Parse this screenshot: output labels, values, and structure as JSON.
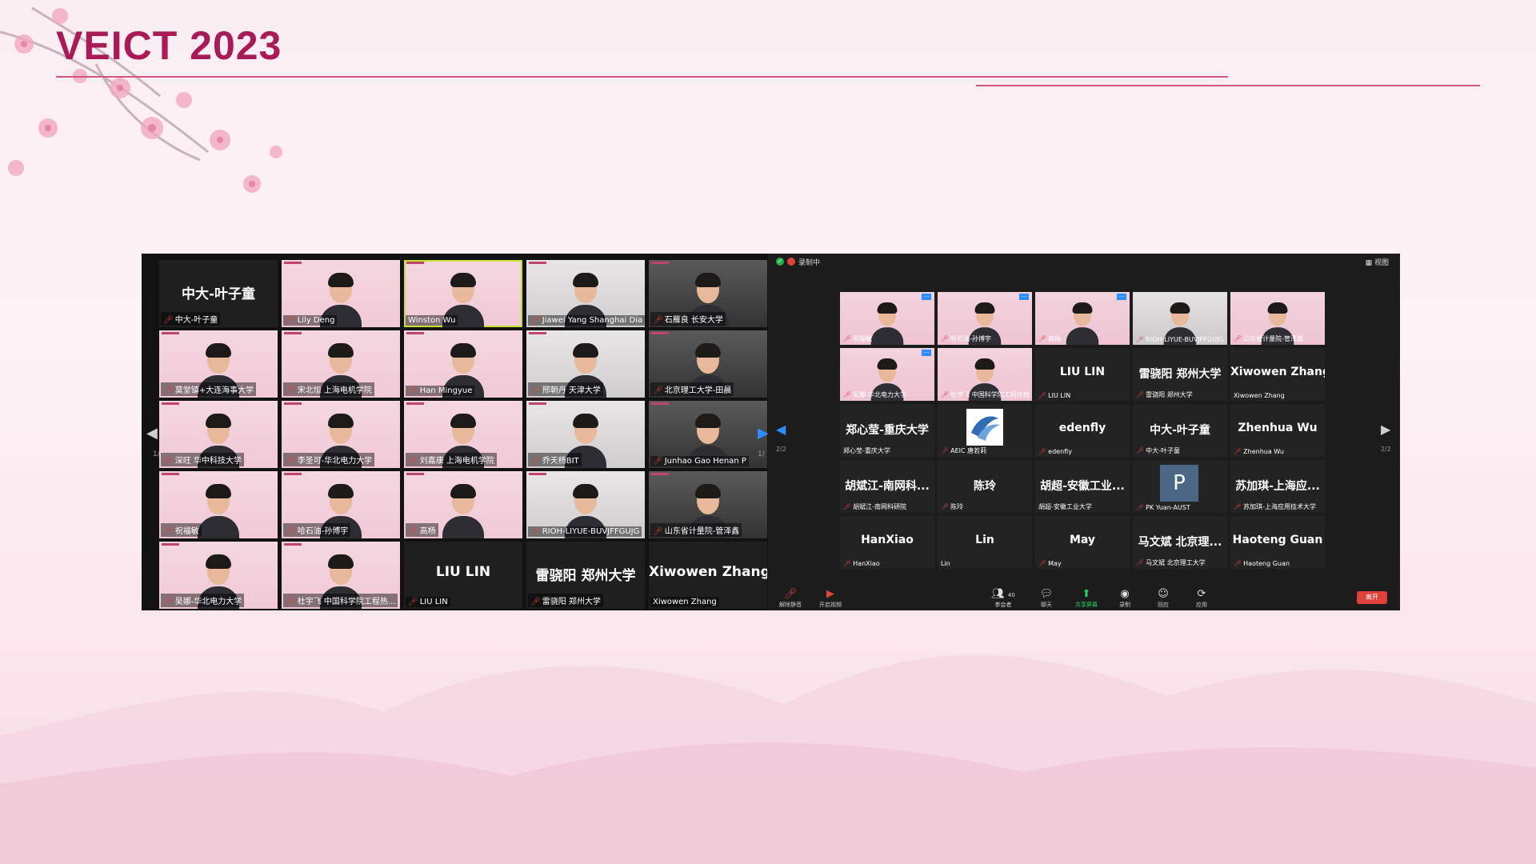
{
  "slide": {
    "title": "VEICT 2023"
  },
  "left_gallery": {
    "page_indicator_left": "1/2",
    "page_indicator_right": "1/",
    "tiles": [
      {
        "label": "中大-叶子童",
        "big": "中大-叶子童",
        "muted": true
      },
      {
        "label": "Lily Deng",
        "muted": true
      },
      {
        "label": "Winston Wu",
        "muted": false
      },
      {
        "label": "Jiawei Yang Shanghai Dia",
        "muted": true
      },
      {
        "label": "石雁良 长安大学",
        "muted": true
      },
      {
        "label": "莫堂镇+大连海事大学",
        "muted": true
      },
      {
        "label": "宋北恒 上海电机学院",
        "muted": true
      },
      {
        "label": "Han Mingyue",
        "muted": true
      },
      {
        "label": "邢朝丹 天津大学",
        "muted": true
      },
      {
        "label": "北京理工大学-田晨",
        "muted": true
      },
      {
        "label": "深旺 华中科技大学",
        "muted": true
      },
      {
        "label": "李圣可-华北电力大学",
        "muted": true
      },
      {
        "label": "刘嘉康 上海电机学院",
        "muted": true
      },
      {
        "label": "乔天杨BIT",
        "muted": true
      },
      {
        "label": "Junhao Gao Henan P",
        "muted": true
      },
      {
        "label": "祝福敏",
        "muted": true
      },
      {
        "label": "哈石油-孙博宇",
        "muted": true
      },
      {
        "label": "高杨",
        "muted": true
      },
      {
        "label": "RIOH-LIYUE-BUVJFFGUJG",
        "muted": true
      },
      {
        "label": "山东省计量院-管泽鑫",
        "muted": true
      },
      {
        "label": "吴娜-华北电力大学",
        "muted": true
      },
      {
        "label": "杜宇飞 中国科学院工程热...",
        "muted": true
      },
      {
        "label": "LIU LIN",
        "big": "LIU LIN",
        "muted": true
      },
      {
        "label": "雷骁阳 郑州大学",
        "big": "雷骁阳 郑州大学",
        "muted": true
      },
      {
        "label": "Xiwowen Zhang",
        "big": "Xiwowen Zhang",
        "muted": false
      }
    ]
  },
  "right_window": {
    "recording_text": "录制中",
    "view_button": "视图",
    "page_indicator_left": "2/2",
    "page_indicator_right": "2/2",
    "tiles": [
      {
        "label": "祝福敏",
        "muted": true
      },
      {
        "label": "哈石油-孙博宇",
        "muted": true
      },
      {
        "label": "高杨",
        "muted": true
      },
      {
        "label": "RIOH-LIYUE-BUVJFFGUJG",
        "muted": true
      },
      {
        "label": "山东省计量院-管泽鑫",
        "muted": true
      },
      {
        "label": "吴娜-华北电力大学",
        "muted": true
      },
      {
        "label": "杜宇飞 中国科学院工程热物...",
        "muted": true
      },
      {
        "label": "LIU LIN",
        "big": "LIU LIN",
        "muted": true
      },
      {
        "label": "雷骁阳 郑州大学",
        "big": "雷骁阳 郑州大学",
        "muted": true
      },
      {
        "label": "Xiwowen Zhang",
        "big": "Xiwowen Zhang",
        "muted": false
      },
      {
        "label": "郑心莹-重庆大学",
        "big": "郑心莹-重庆大学",
        "muted": false
      },
      {
        "label": "AEIC 唐若莉",
        "muted": true
      },
      {
        "label": "edenfly",
        "big": "edenfly",
        "muted": true
      },
      {
        "label": "中大-叶子童",
        "big": "中大-叶子童",
        "muted": true
      },
      {
        "label": "Zhenhua Wu",
        "big": "Zhenhua Wu",
        "muted": true
      },
      {
        "label": "胡斌江-南网科研院",
        "big": "胡斌江-南网科...",
        "muted": true
      },
      {
        "label": "陈玲",
        "big": "陈玲",
        "muted": true
      },
      {
        "label": "胡超-安徽工业大学",
        "big": "胡超-安徽工业...",
        "muted": false
      },
      {
        "label": "PK Yuan-AUST",
        "avatar": "P",
        "muted": true
      },
      {
        "label": "苏加琪-上海应用技术大学",
        "big": "苏加琪-上海应...",
        "muted": true
      },
      {
        "label": "HanXiao",
        "big": "HanXiao",
        "muted": true
      },
      {
        "label": "Lin",
        "big": "Lin",
        "muted": false
      },
      {
        "label": "May",
        "big": "May",
        "muted": true
      },
      {
        "label": "马文斌 北京理工大学",
        "big": "马文斌  北京理...",
        "muted": true
      },
      {
        "label": "Haoteng Guan",
        "big": "Haoteng Guan",
        "muted": true
      }
    ],
    "toolbar": {
      "unmute": "解除静音",
      "start_video": "开启视频",
      "participants": "参会者",
      "participants_count": "40",
      "chat": "聊天",
      "share": "共享屏幕",
      "record": "录制",
      "reactions": "回应",
      "apps": "应用",
      "leave": "离开"
    }
  },
  "colors": {
    "accent": "#a81b56",
    "zoom_blue": "#2d8cff",
    "muted_red": "#e0413b",
    "share_green": "#23d962",
    "speaker_border": "#c8e02f"
  }
}
